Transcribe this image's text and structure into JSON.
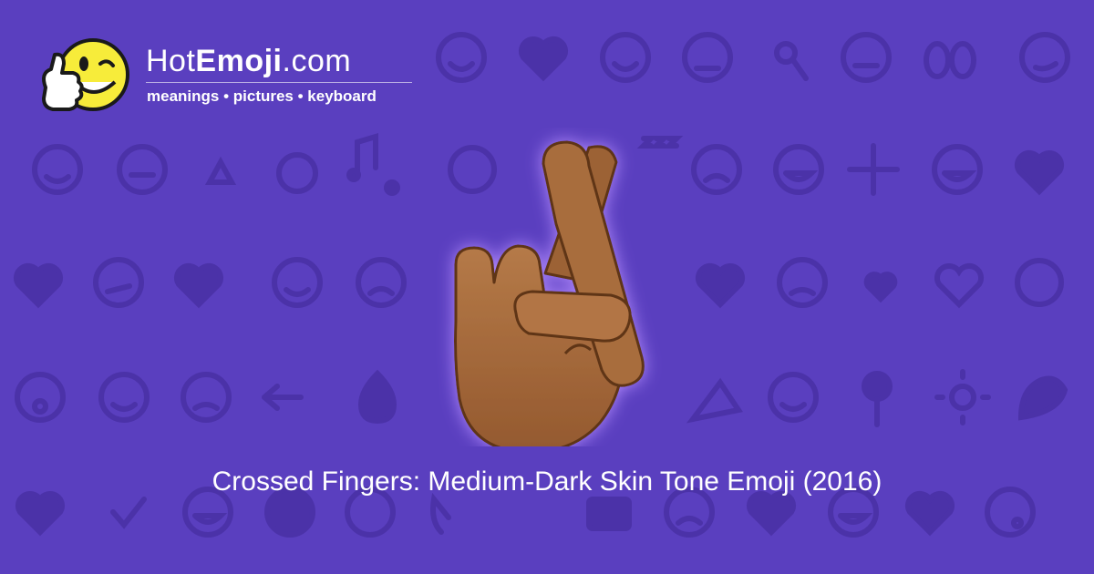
{
  "site": {
    "name_prefix": "Hot",
    "name_bold": "Emoji",
    "name_suffix": ".com",
    "tagline": "meanings • pictures • keyboard",
    "logo_icon": "winking-thumbs-up-smiley-icon"
  },
  "hero": {
    "icon": "crossed-fingers-medium-dark-skin-tone-icon"
  },
  "caption": "Crossed Fingers: Medium-Dark Skin Tone Emoji (2016)",
  "colors": {
    "background": "#5a3fbf",
    "pattern": "#4b32a8",
    "logo_yellow": "#f7ec3a",
    "skin": "#a56a3c",
    "glow": "#b58cff",
    "text": "#ffffff"
  },
  "background_pattern": {
    "icons": [
      "smiley",
      "heart",
      "sparkles",
      "ok-hand",
      "monkey",
      "music-notes",
      "fire",
      "rose",
      "sun",
      "flexed-biceps",
      "camera",
      "check-mark",
      "broken-heart",
      "recycle",
      "arrow-left"
    ]
  }
}
